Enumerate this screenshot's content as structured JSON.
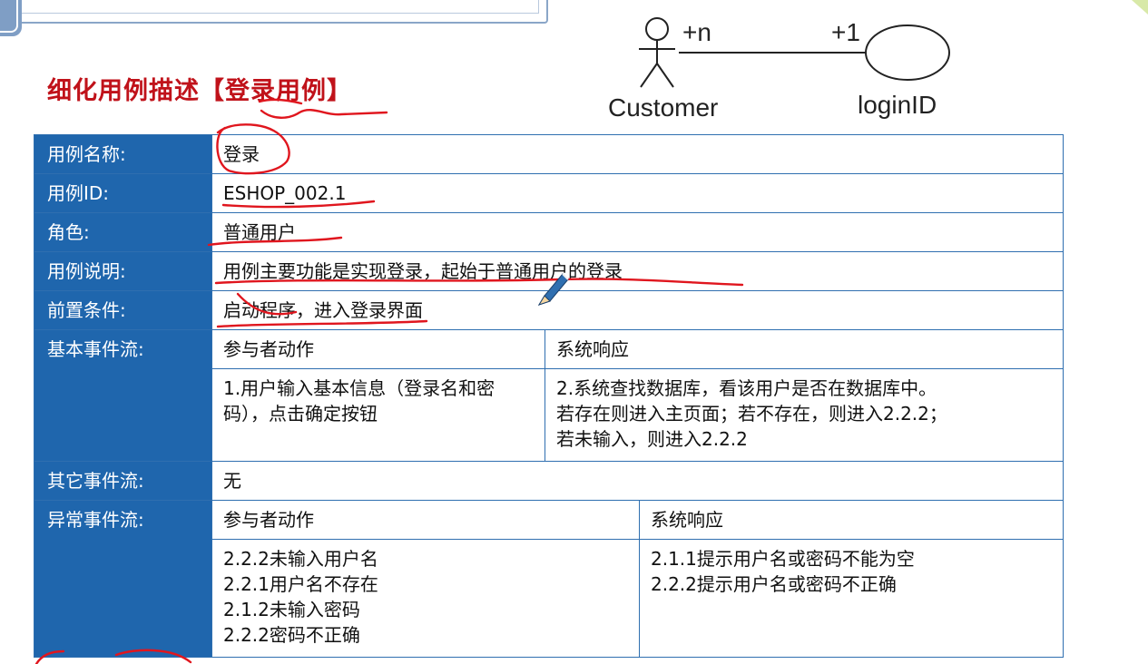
{
  "title": "细化用例描述【登录用例】",
  "uml": {
    "actor": "Customer",
    "usecase": "loginID",
    "actor_mult": "+n",
    "usecase_mult": "+1"
  },
  "rows": {
    "name": {
      "label": "用例名称:",
      "value": "登录"
    },
    "id": {
      "label": "用例ID:",
      "value": "ESHOP_002.1"
    },
    "role": {
      "label": "角色:",
      "value": "普通用户"
    },
    "desc": {
      "label": "用例说明:",
      "value": "用例主要功能是实现登录，起始于普通用户的登录"
    },
    "pre": {
      "label": "前置条件:",
      "value": "启动程序，进入登录界面"
    },
    "basic": {
      "label": "基本事件流:",
      "col_actor": "参与者动作",
      "col_system": "系统响应",
      "actor_text": "1.用户输入基本信息（登录名和密码），点击确定按钮",
      "system_text": "2.系统查找数据库，看该用户是否在数据库中。\n若存在则进入主页面；若不存在，则进入2.2.2；\n若未输入，则进入2.2.2"
    },
    "other": {
      "label": "其它事件流:",
      "value": "无"
    },
    "exception": {
      "label": "异常事件流:",
      "col_actor": "参与者动作",
      "col_system": "系统响应",
      "actor_text": "2.2.2未输入用户名\n2.2.1用户名不存在\n2.1.2未输入密码\n2.2.2密码不正确",
      "system_text": "2.1.1提示用户名或密码不能为空\n2.2.2提示用户名或密码不正确"
    }
  },
  "colors": {
    "header_bg": "#1f66ad",
    "border": "#2f6fb0",
    "title": "#c0121a",
    "annotation": "#e0161e"
  }
}
